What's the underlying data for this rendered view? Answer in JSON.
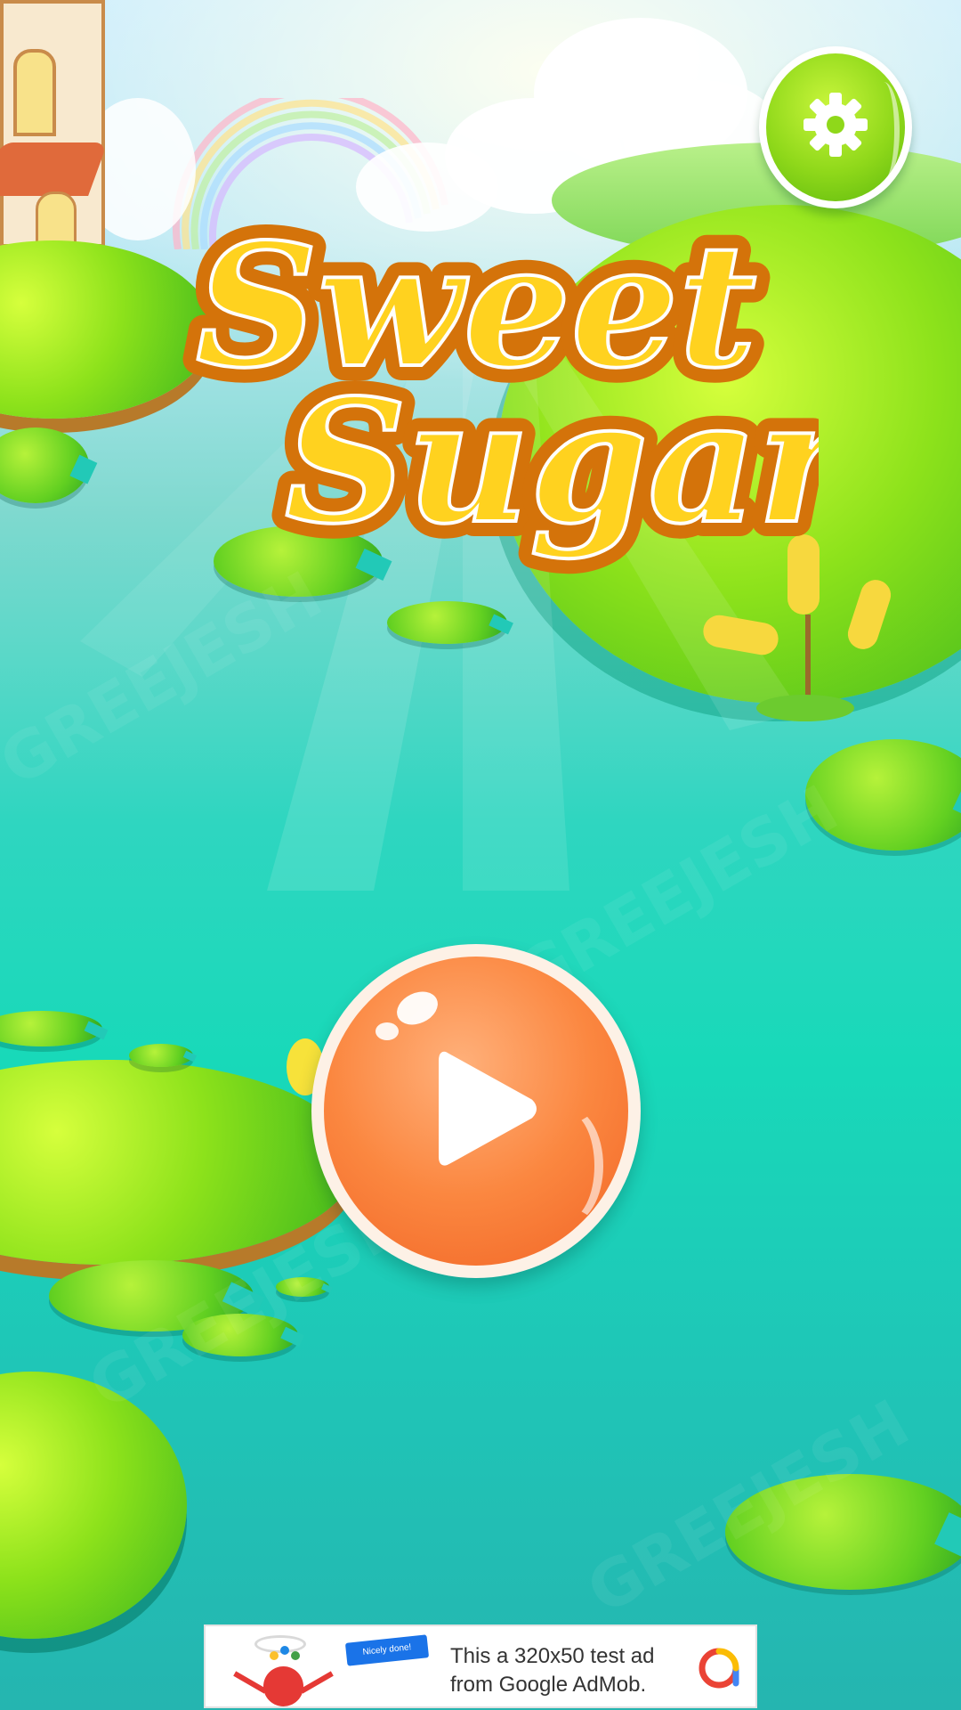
{
  "title": {
    "line1": "Sweet",
    "line2": "Sugar"
  },
  "buttons": {
    "settings_icon": "gear-icon",
    "play_icon": "play-icon"
  },
  "ad": {
    "badge": "Nicely done!",
    "text_line1": "This a 320x50 test ad",
    "text_line2": "from Google AdMob.",
    "logo_icon": "admob-logo-icon"
  },
  "watermark": "GREEJESH",
  "colors": {
    "settings": "#8fd81a",
    "play": "#fb8740",
    "water": "#18d9b9",
    "title_fill": "#ffd21f",
    "title_outline": "#d4730a"
  }
}
